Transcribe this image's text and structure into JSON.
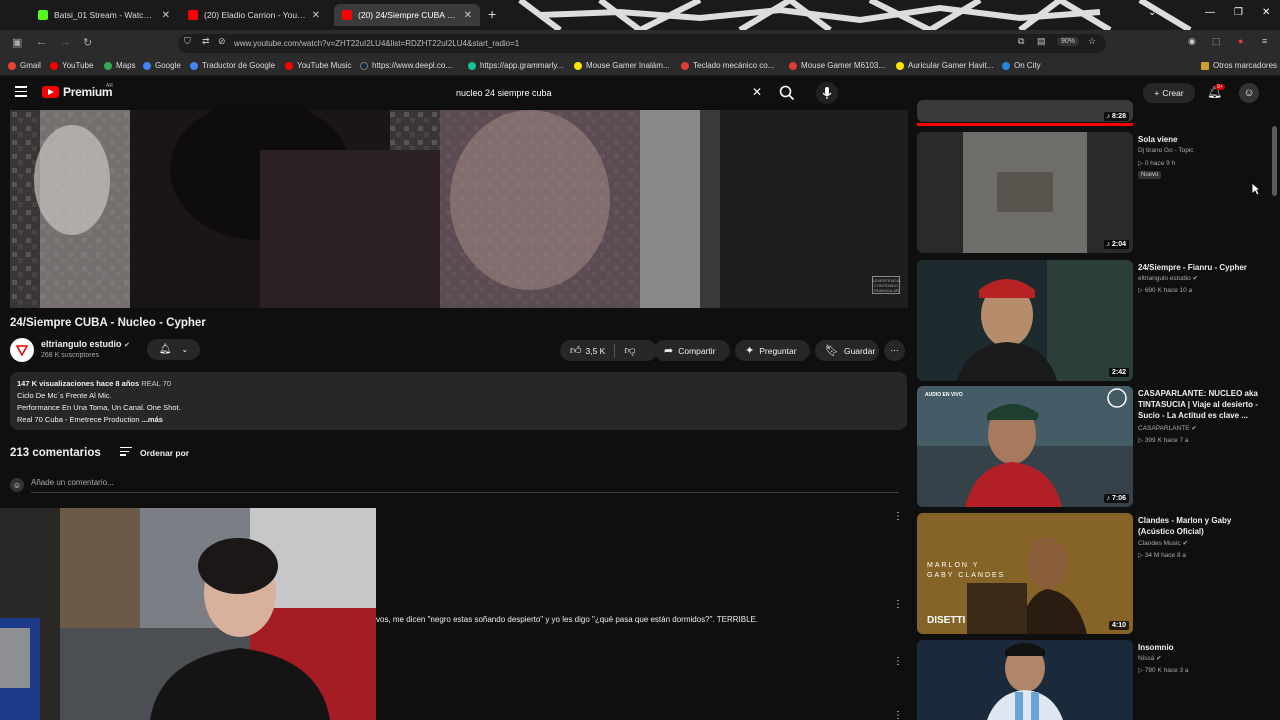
{
  "browser": {
    "tabs": [
      {
        "title": "Batsi_01 Stream - Watch Live on",
        "favicon_color": "#53fc18"
      },
      {
        "title": "(20) Eladio Carrion - YouTube",
        "favicon_color": "#ff0000"
      },
      {
        "title": "(20) 24/Siempre CUBA - Nucleo",
        "favicon_color": "#ff0000"
      }
    ],
    "url": "www.youtube.com/watch?v=ZHT22uI2LU4&list=RDZHT22uI2LU4&start_radio=1",
    "zoom": "90%",
    "bookmarks": [
      {
        "label": "Gmail",
        "color": "#ea4335"
      },
      {
        "label": "YouTube",
        "color": "#ff0000"
      },
      {
        "label": "Maps",
        "color": "#34a853"
      },
      {
        "label": "Google",
        "color": "#4285f4"
      },
      {
        "label": "Traductor de Google",
        "color": "#4285f4"
      },
      {
        "label": "YouTube Music",
        "color": "#ff0000"
      },
      {
        "label": "https://www.deepl.co...",
        "color": "#0f2b46"
      },
      {
        "label": "https://app.grammarly...",
        "color": "#15c39a"
      },
      {
        "label": "Mouse Gamer Inalám...",
        "color": "#ffe600"
      },
      {
        "label": "Teclado mecánico co...",
        "color": "#e53935"
      },
      {
        "label": "Mouse Gamer M6103...",
        "color": "#e53935"
      },
      {
        "label": "Auricular Gamer Havit...",
        "color": "#ffe600"
      },
      {
        "label": "On City",
        "color": "#1e88e5"
      }
    ],
    "other_bookmarks": "Otros marcadores"
  },
  "header": {
    "logo_text": "Premium",
    "logo_region": "AR",
    "search_query": "nucleo 24 siempre cuba",
    "create_label": "Crear",
    "notif_badge": "9+"
  },
  "video": {
    "watermark": "ADVERTENCIA CONTENIDO TRIANGULAR",
    "title": "24/Siempre CUBA - Nucleo - Cypher",
    "channel": "eltriangulo estudio",
    "subscribers": "268 K suscriptores",
    "likes": "3,5 K",
    "share_label": "Compartir",
    "ask_label": "Preguntar",
    "save_label": "Guardar"
  },
  "description": {
    "views": "147 K visualizaciones",
    "age": "hace 8 años",
    "tag": "REAL 70",
    "lines": [
      "Ciclo De Mc´s Frente Al Mic.",
      "Performance En Una Toma, Un Canal. One Shot.",
      "Real 70 Cuba - Emetrece Production"
    ],
    "more": "...más"
  },
  "comments": {
    "count": "213 comentarios",
    "sort_label": "Ordenar por",
    "add_placeholder": "Añade un comentario...",
    "visible_text": "vos, me dicen \"negro estas soñando despierto\" y yo les digo \"¿qué pasa que están dormidos?\". TERRIBLE."
  },
  "recommendations": [
    {
      "title": "",
      "channel": "",
      "meta": "",
      "duration": "8:28"
    },
    {
      "title": "Sola viene",
      "channel": "Dj tirano Go - Topic",
      "meta": "0   hace 9 h",
      "badge": "Nuevo",
      "duration": "2:04"
    },
    {
      "title": "24/Siempre - Fianru - Cypher",
      "channel": "eltriangulo estudio",
      "meta": "690 K   hace 10 a",
      "duration": "2:42"
    },
    {
      "title": "CASAPARLANTE: NUCLEO aka TINTASUCIA | Viaje al desierto - Sucio - La Actitud es clave ...",
      "channel": "CASAPARLANTE",
      "meta": "399 K   hace 7 a",
      "duration": "7:06",
      "thumb_label": "AUDIO EN VIVO"
    },
    {
      "title": "Clandes - Marlon y Gaby (Acústico Oficial)",
      "channel": "Clandes Music",
      "meta": "34 M   hace 8 a",
      "duration": "4:10",
      "thumb_label": "MARLON Y GABY CLANDES",
      "thumb_label2": "DISETTI"
    },
    {
      "title": "Insomnio",
      "channel": "Nissa",
      "meta": "790 K   hace 3 a",
      "duration": ""
    }
  ]
}
